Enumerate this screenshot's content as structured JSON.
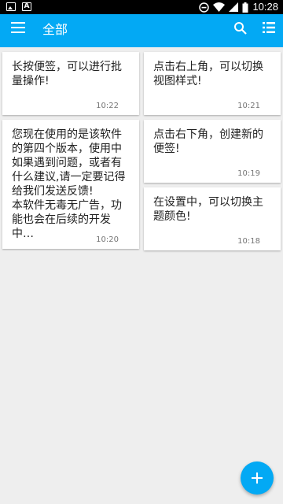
{
  "status_bar": {
    "time": "10:28"
  },
  "app_bar": {
    "title": "全部"
  },
  "notes_left": [
    {
      "text": "长按便签，可以进行批量操作!",
      "time": "10:22"
    },
    {
      "text": "您现在使用的是该软件的第四个版本，使用中如果遇到问题，或者有什么建议,请一定要记得给我们发送反馈!\n本软件无毒无广告，功能也会在后续的开发中…",
      "time": "10:20"
    }
  ],
  "notes_right": [
    {
      "text": "点击右上角，可以切换视图样式!",
      "time": "10:21"
    },
    {
      "text": "点击右下角，创建新的便签!",
      "time": "10:19"
    },
    {
      "text": "在设置中，可以切换主题颜色!",
      "time": "10:18"
    }
  ],
  "colors": {
    "accent": "#03a9f4",
    "status_bar": "#000000",
    "background": "#eeeeee"
  }
}
